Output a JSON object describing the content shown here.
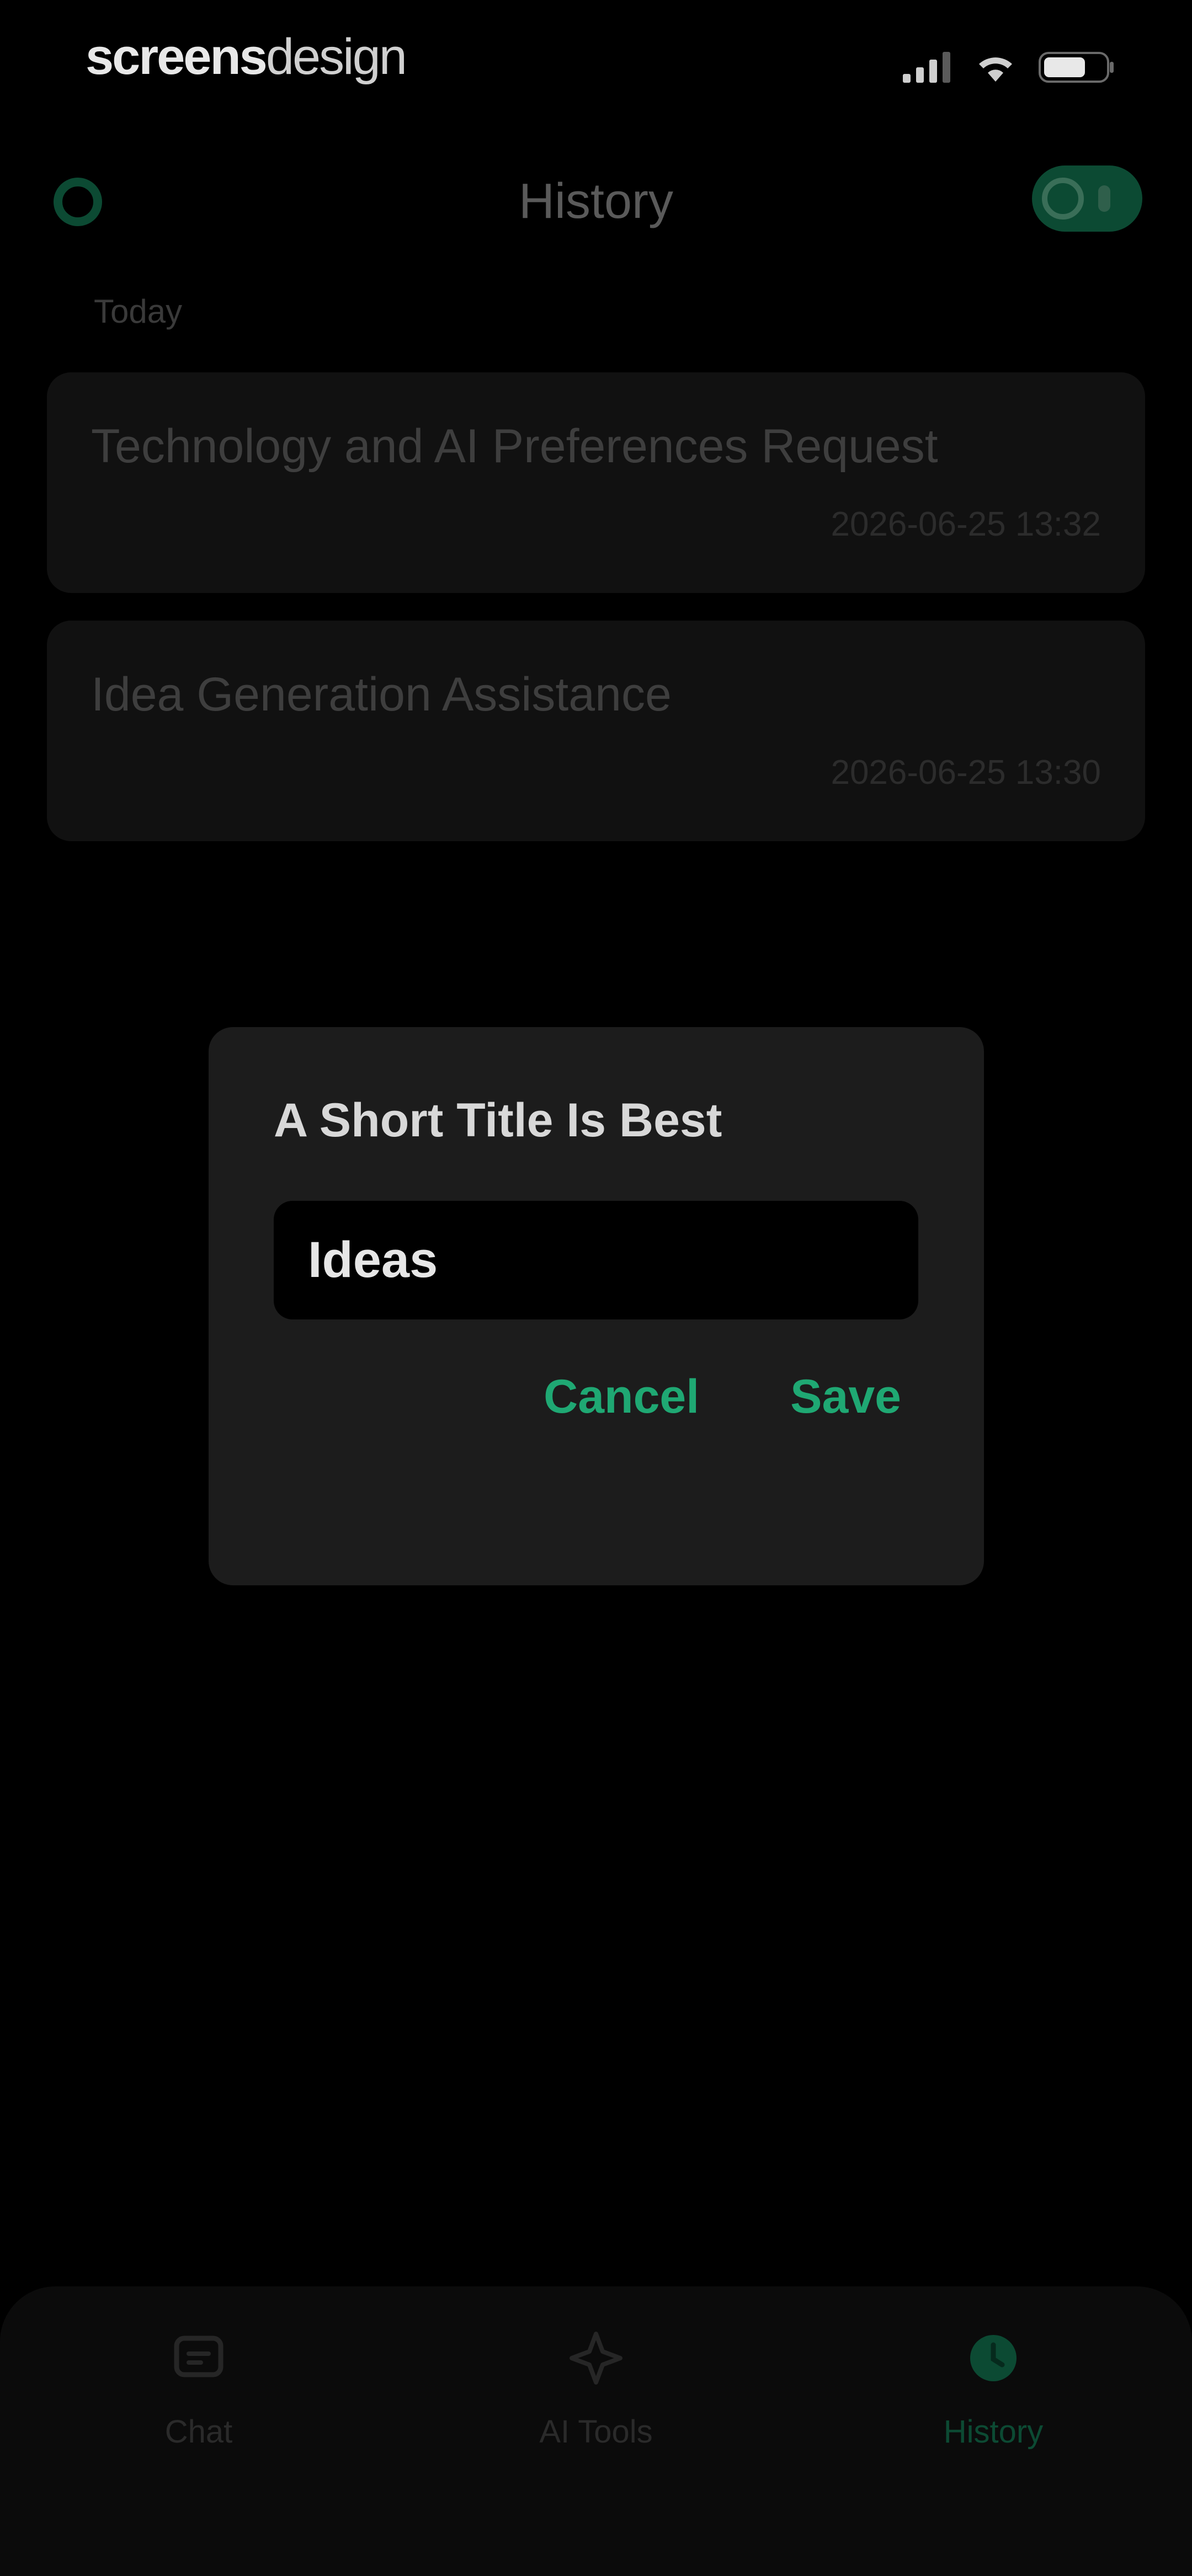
{
  "status_bar": {
    "brand_part1": "screens",
    "brand_part2": "design"
  },
  "header": {
    "title": "History"
  },
  "history": {
    "section_label": "Today",
    "items": [
      {
        "title": "Technology and AI Preferences Request",
        "time": "2026-06-25 13:32"
      },
      {
        "title": "Idea Generation Assistance",
        "time": "2026-06-25 13:30"
      }
    ]
  },
  "dialog": {
    "title": "A Short Title Is Best",
    "input_value": "Ideas",
    "cancel_label": "Cancel",
    "save_label": "Save"
  },
  "tabbar": {
    "tabs": [
      {
        "label": "Chat",
        "icon": "chat-icon"
      },
      {
        "label": "AI Tools",
        "icon": "ai-tools-icon"
      },
      {
        "label": "History",
        "icon": "history-icon"
      }
    ],
    "active": "History"
  },
  "colors": {
    "accent": "#1fa873",
    "background": "#000000",
    "dialog_background": "#1c1c1c",
    "card_background": "#111111"
  }
}
